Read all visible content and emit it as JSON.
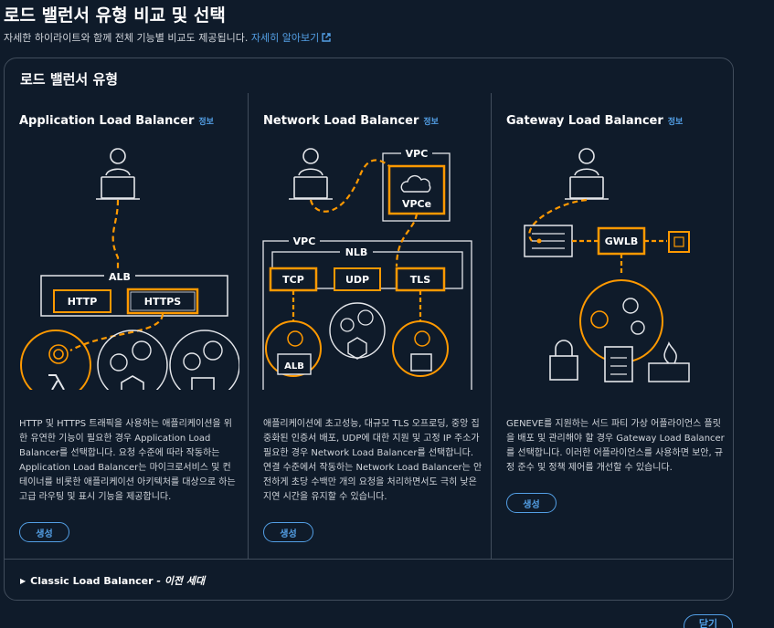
{
  "page": {
    "title": "로드 밸런서 유형 비교 및 선택",
    "subtitle": "자세한 하이라이트와 함께 전체 기능별 비교도 제공됩니다.",
    "learn_more": "자세히 알아보기"
  },
  "panel": {
    "title": "로드 밸런서 유형",
    "types": [
      {
        "name": "Application Load Balancer",
        "info": "정보",
        "labels": {
          "group": "ALB",
          "left": "HTTP",
          "right": "HTTPS"
        },
        "description": "HTTP 및 HTTPS 트래픽을 사용하는 애플리케이션을 위한 유연한 기능이 필요한 경우 Application Load Balancer를 선택합니다. 요청 수준에 따라 작동하는 Application Load Balancer는 마이크로서비스 및 컨테이너를 비롯한 애플리케이션 아키텍처를 대상으로 하는 고급 라우팅 및 표시 기능을 제공합니다.",
        "create_label": "생성"
      },
      {
        "name": "Network Load Balancer",
        "info": "정보",
        "labels": {
          "vpc_top": "VPC",
          "vpce": "VPCe",
          "vpc": "VPC",
          "nlb": "NLB",
          "tcp": "TCP",
          "udp": "UDP",
          "tls": "TLS",
          "alb": "ALB"
        },
        "description": "애플리케이션에 초고성능, 대규모 TLS 오프로딩, 중앙 집중화된 인증서 배포, UDP에 대한 지원 및 고정 IP 주소가 필요한 경우 Network Load Balancer를 선택합니다. 연결 수준에서 작동하는 Network Load Balancer는 안전하게 초당 수백만 개의 요청을 처리하면서도 극히 낮은 지연 시간을 유지할 수 있습니다.",
        "create_label": "생성"
      },
      {
        "name": "Gateway Load Balancer",
        "info": "정보",
        "labels": {
          "gwlb": "GWLB"
        },
        "description": "GENEVE를 지원하는 서드 파티 가상 어플라이언스 플릿을 배포 및 관리해야 할 경우 Gateway Load Balancer를 선택합니다. 이러한 어플라이언스를 사용하면 보안, 규정 준수 및 정책 제어를 개선할 수 있습니다.",
        "create_label": "생성"
      }
    ],
    "classic": {
      "name": "Classic Load Balancer",
      "suffix": "- 이전 세대"
    }
  },
  "footer": {
    "close_label": "닫기"
  },
  "colors": {
    "accent": "#ff9900",
    "link": "#539fe5",
    "border": "#414d5c",
    "background": "#0f1b2a"
  }
}
